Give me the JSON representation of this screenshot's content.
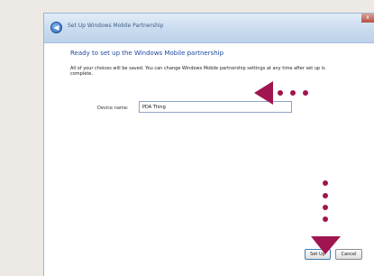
{
  "window": {
    "title": "Set Up Windows Mobile Partnership",
    "close_label": "x",
    "back_label": "◀"
  },
  "main": {
    "heading": "Ready to set up the Windows Mobile partnership",
    "description": "All of your choices will be saved. You can change Windows Mobile partnership settings at any time after set up is complete.",
    "device_name_label": "Device name:",
    "device_name_value": "PDA Thing"
  },
  "buttons": {
    "setup_label": "Set Up",
    "cancel_label": "Cancel"
  },
  "annotations": {
    "color": "#a0154f"
  }
}
